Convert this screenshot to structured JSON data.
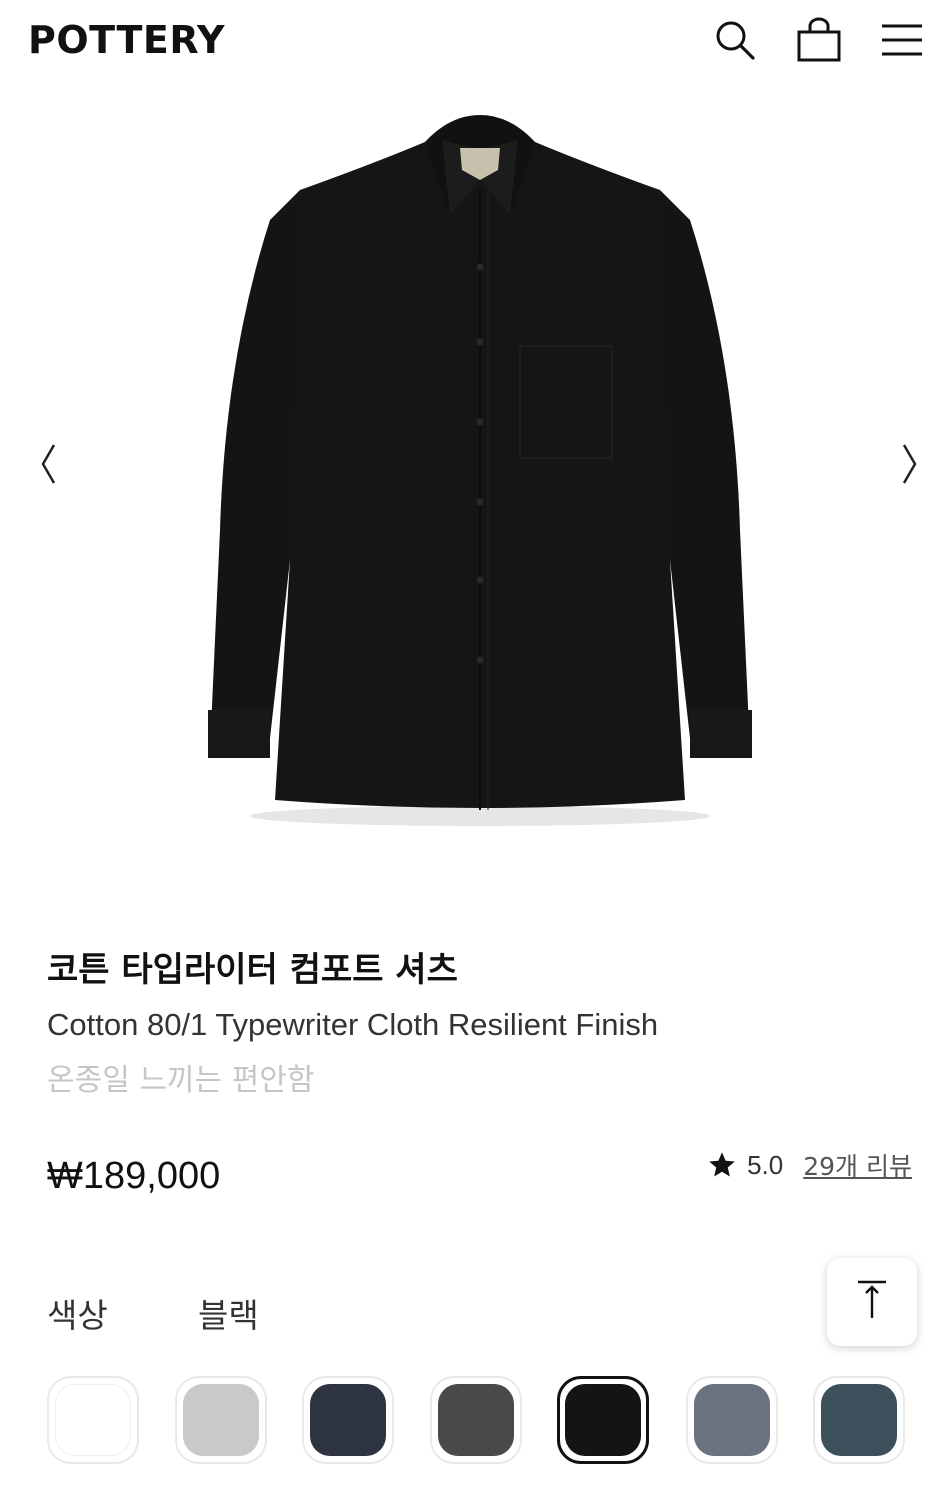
{
  "header": {
    "logo": "POTTERY",
    "icons": [
      "search-icon",
      "shopping-bag-icon",
      "menu-icon"
    ]
  },
  "gallery": {
    "image_alt": "black cotton shirt",
    "prev_icon": "chevron-left-icon",
    "next_icon": "chevron-right-icon"
  },
  "product": {
    "title_ko": "코튼 타입라이터 컴포트 셔츠",
    "title_en": "Cotton 80/1 Typewriter Cloth Resilient Finish",
    "tagline": "온종일 느끼는 편안함",
    "price": "₩189,000",
    "rating": "5.0",
    "reviews_link": "29개 리뷰"
  },
  "color": {
    "label": "색상",
    "selected": "블랙",
    "swatches": [
      {
        "name": "white",
        "hex": "#ffffff"
      },
      {
        "name": "light-gray",
        "hex": "#c9c9cb"
      },
      {
        "name": "navy",
        "hex": "#2e3440"
      },
      {
        "name": "charcoal",
        "hex": "#4a4a4c"
      },
      {
        "name": "black",
        "hex": "#141414",
        "selected": true
      },
      {
        "name": "slate-gray",
        "hex": "#6b7380"
      },
      {
        "name": "teal-gray",
        "hex": "#3d4f5b"
      }
    ]
  },
  "scroll_top_icon": "arrow-up-to-top-icon"
}
